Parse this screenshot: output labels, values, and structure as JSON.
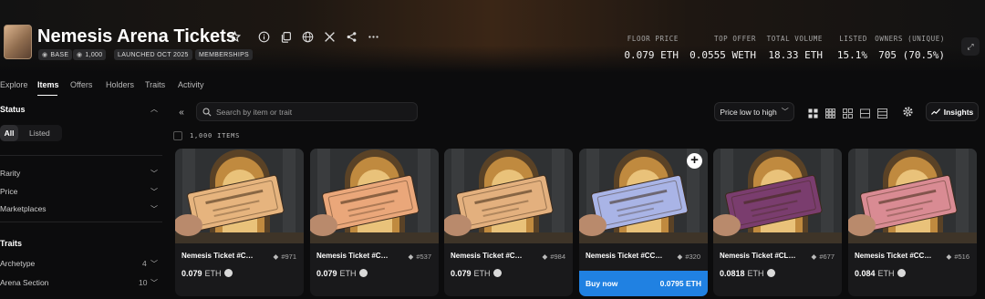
{
  "collection": {
    "title": "Nemesis Arena Tickets",
    "badges": [
      "BASE",
      "1,000",
      "LAUNCHED OCT 2025",
      "MEMBERSHIPS"
    ]
  },
  "stats": [
    {
      "label": "FLOOR PRICE",
      "value": "0.079 ETH"
    },
    {
      "label": "TOP OFFER",
      "value": "0.0555 WETH"
    },
    {
      "label": "TOTAL VOLUME",
      "value": "18.33 ETH"
    },
    {
      "label": "LISTED",
      "value": "15.1%"
    },
    {
      "label": "OWNERS (UNIQUE)",
      "value": "705 (70.5%)"
    }
  ],
  "tabs": [
    "Explore",
    "Items",
    "Offers",
    "Holders",
    "Traits",
    "Activity"
  ],
  "active_tab": "Items",
  "sidebar": {
    "status": {
      "label": "Status",
      "options": [
        "All",
        "Listed"
      ]
    },
    "filters": [
      "Rarity",
      "Price",
      "Marketplaces"
    ],
    "traits": {
      "label": "Traits",
      "items": [
        {
          "label": "Archetype",
          "count": "4"
        },
        {
          "label": "Arena Section",
          "count": "10"
        }
      ]
    }
  },
  "toolbar": {
    "search_placeholder": "Search by item or trait",
    "sort_label": "Price low to high",
    "insights_label": "Insights"
  },
  "items_count": "1,000 ITEMS",
  "items": [
    {
      "name": "Nemesis Ticket #C…",
      "number": "#971",
      "price": "0.079",
      "unit": "ETH",
      "ticket_color": "#e6b47e"
    },
    {
      "name": "Nemesis Ticket #C…",
      "number": "#537",
      "price": "0.079",
      "unit": "ETH",
      "ticket_color": "#eaa77a"
    },
    {
      "name": "Nemesis Ticket #C…",
      "number": "#984",
      "price": "0.079",
      "unit": "ETH",
      "ticket_color": "#e3b07e"
    },
    {
      "name": "Nemesis Ticket #CC…",
      "number": "#320",
      "price": "0.0795 ETH",
      "unit": "",
      "buy_label": "Buy now",
      "ticket_color": "#a9b4e6"
    },
    {
      "name": "Nemesis Ticket #CL…",
      "number": "#677",
      "price": "0.0818",
      "unit": "ETH",
      "ticket_color": "#7a3d6e"
    },
    {
      "name": "Nemesis Ticket #CC…",
      "number": "#516",
      "price": "0.084",
      "unit": "ETH",
      "ticket_color": "#d98b93"
    }
  ],
  "colors": {
    "accent": "#2081e2",
    "background": "#0c0c0d",
    "card": "#19191b"
  }
}
